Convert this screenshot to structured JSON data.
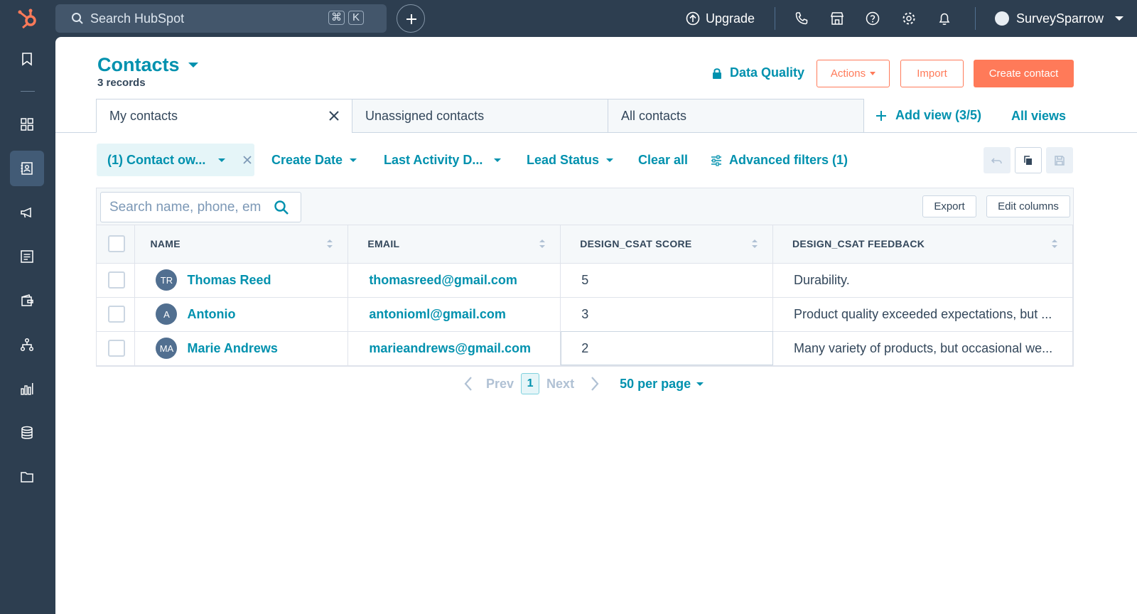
{
  "topbar": {
    "search_placeholder": "Search HubSpot",
    "shortcut_keys": [
      "⌘",
      "K"
    ],
    "upgrade_label": "Upgrade",
    "account_name": "SurveySparrow"
  },
  "page": {
    "title": "Contacts",
    "records_count": "3 records",
    "data_quality_label": "Data Quality",
    "actions_label": "Actions",
    "import_label": "Import",
    "create_label": "Create contact"
  },
  "views": {
    "tabs": [
      "My contacts",
      "Unassigned contacts",
      "All contacts"
    ],
    "add_view_label": "Add view (3/5)",
    "all_views_label": "All views"
  },
  "filters": {
    "active_chip": "(1) Contact ow...",
    "create_date": "Create Date",
    "last_activity": "Last Activity D...",
    "lead_status": "Lead Status",
    "clear_all": "Clear all",
    "advanced": "Advanced filters (1)"
  },
  "table": {
    "search_placeholder": "Search name, phone, em",
    "export_label": "Export",
    "edit_columns_label": "Edit columns",
    "columns": [
      "NAME",
      "EMAIL",
      "DESIGN_CSAT SCORE",
      "DESIGN_CSAT FEEDBACK"
    ],
    "rows": [
      {
        "initials": "TR",
        "name": "Thomas Reed",
        "email": "thomasreed@gmail.com",
        "score": "5",
        "feedback": "Durability."
      },
      {
        "initials": "A",
        "name": "Antonio",
        "email": "antonioml@gmail.com",
        "score": "3",
        "feedback": "Product quality exceeded expectations, but ..."
      },
      {
        "initials": "MA",
        "name": "Marie Andrews",
        "email": "marieandrews@gmail.com",
        "score": "2",
        "feedback": "Many variety of products, but occasional we..."
      }
    ]
  },
  "pagination": {
    "prev": "Prev",
    "current": "1",
    "next": "Next",
    "per_page": "50 per page"
  },
  "colors": {
    "nav_bg": "#2d3e50",
    "link": "#0091ae",
    "accent": "#ff7a59"
  }
}
